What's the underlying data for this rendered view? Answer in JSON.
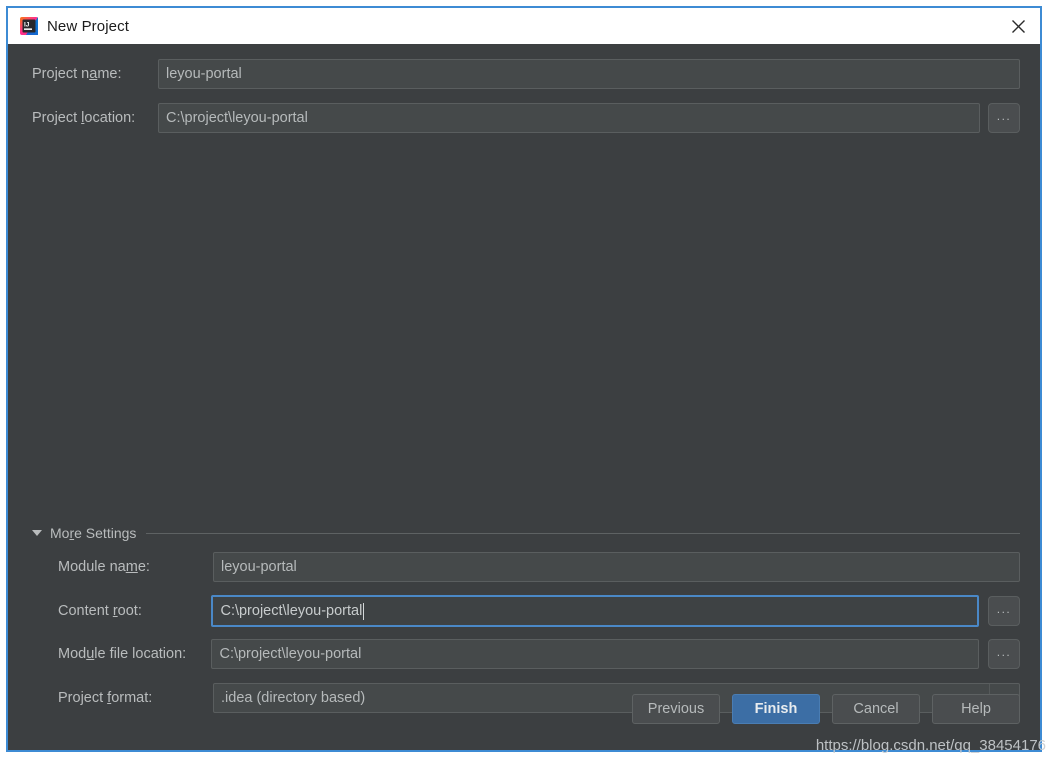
{
  "window": {
    "title": "New Project",
    "icon": "intellij-idea-icon",
    "close_icon": "close-icon",
    "frame_color": "#3d8bd4",
    "background": "#3c3f41"
  },
  "top_form": {
    "fields": [
      {
        "label_before": "Project n",
        "label_mnemonic": "a",
        "label_after": "me:",
        "value": "leyou-portal",
        "name": "project-name",
        "has_browse": false
      },
      {
        "label_before": "Project ",
        "label_mnemonic": "l",
        "label_after": "ocation:",
        "value": "C:\\project\\leyou-portal",
        "name": "project-location",
        "has_browse": true,
        "browse_label": "..."
      }
    ]
  },
  "more_settings": {
    "label_before": "Mo",
    "label_mnemonic": "r",
    "label_after": "e Settings",
    "expanded": true,
    "arrow_icon": "triangle-down-icon"
  },
  "settings_form": {
    "fields": [
      {
        "label_before": "Module na",
        "label_mnemonic": "m",
        "label_after": "e:",
        "value": "leyou-portal",
        "name": "module-name",
        "focused": false,
        "has_browse": false
      },
      {
        "label_before": "Content ",
        "label_mnemonic": "r",
        "label_after": "oot:",
        "value": "C:\\project\\leyou-portal",
        "name": "content-root",
        "focused": true,
        "has_browse": true,
        "browse_label": "..."
      },
      {
        "label_before": "Mod",
        "label_mnemonic": "u",
        "label_after": "le file location:",
        "value": "C:\\project\\leyou-portal",
        "name": "module-file-location",
        "focused": false,
        "has_browse": true,
        "browse_label": "..."
      }
    ],
    "project_format": {
      "label_before": "Project ",
      "label_mnemonic": "f",
      "label_after": "ormat:",
      "value": ".idea (directory based)",
      "arrow_icon": "chevron-down-icon"
    }
  },
  "buttons": [
    {
      "label": "Previous",
      "name": "previous-button",
      "primary": false
    },
    {
      "label": "Finish",
      "name": "finish-button",
      "primary": true
    },
    {
      "label": "Cancel",
      "name": "cancel-button",
      "primary": false
    },
    {
      "label": "Help",
      "name": "help-button",
      "primary": false
    }
  ],
  "watermark": {
    "text": "https://blog.csdn.net/qq_38454176"
  },
  "colors": {
    "accent": "#3c6ea5",
    "focus_border": "#4a88c7",
    "frame": "#3d8bd4",
    "panel": "#3c3f41",
    "field": "#45494a",
    "text": "#b6babb"
  }
}
